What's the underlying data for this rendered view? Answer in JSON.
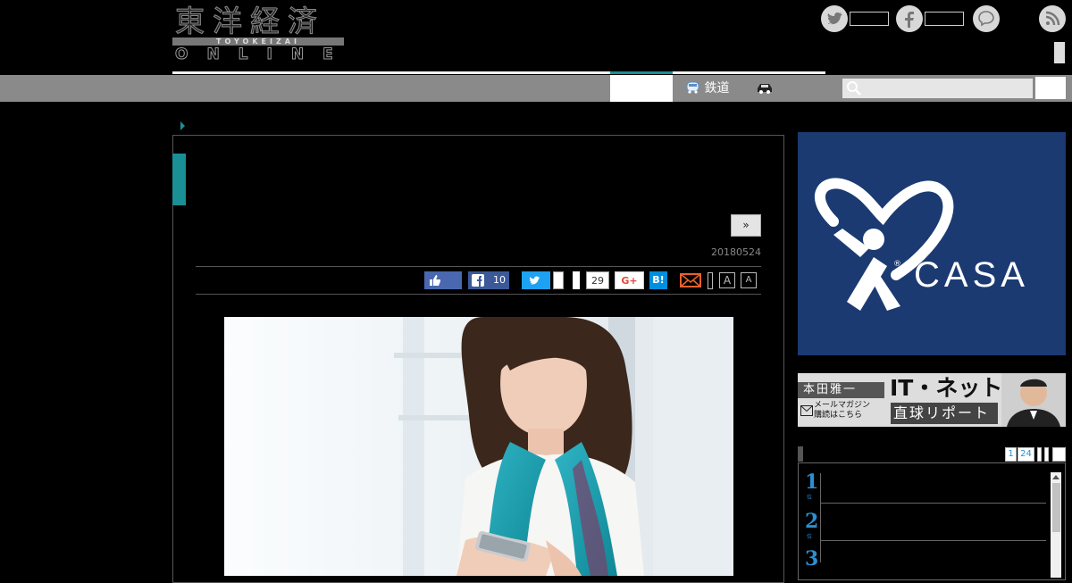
{
  "header": {
    "logo_main": "東洋経済",
    "logo_band": "TOYOKEIZAI",
    "logo_sub": "ONLINE"
  },
  "nav": {
    "items": [
      {
        "label": "鉄道",
        "icon": "train-icon"
      },
      {
        "label": "",
        "icon": "car-icon"
      }
    ]
  },
  "search": {
    "placeholder": ""
  },
  "article": {
    "next_label": "»",
    "date": "20180524",
    "share": {
      "facebook_count": "10",
      "twitter_count": "29",
      "gplus_label": "G+",
      "hatena_label": "B!",
      "font_small": "A",
      "font_large": "A"
    }
  },
  "sidebar": {
    "ad_casa_text": "CASA",
    "ad_casa_mark": "®",
    "ad_honda": {
      "name": "本田雅一",
      "mail_line1": "メールマガジン",
      "mail_line2": "購読はこちら",
      "title_top": "IT・ネット",
      "title_bottom": "直球リポート"
    },
    "ranking_tabs": [
      "1",
      "24"
    ],
    "ranking": [
      {
        "num": "1",
        "suffix": "位"
      },
      {
        "num": "2",
        "suffix": "位"
      },
      {
        "num": "3",
        "suffix": "位"
      }
    ]
  },
  "colors": {
    "accent": "#1a8f96",
    "nav_gray": "#8a8a8a",
    "casa_blue": "#1b3a72"
  }
}
